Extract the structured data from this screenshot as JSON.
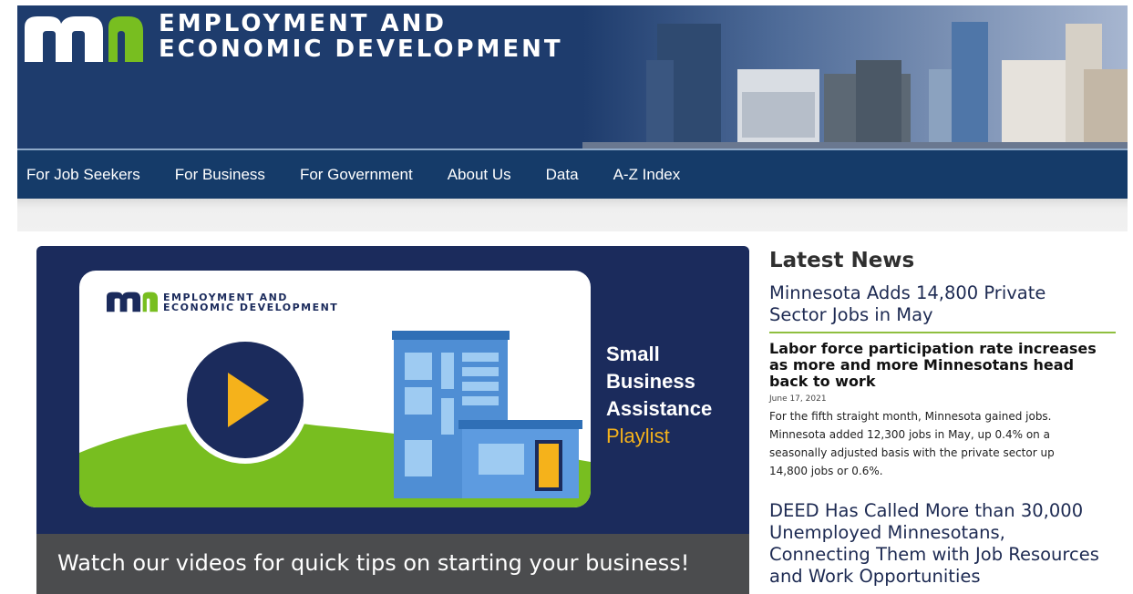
{
  "header": {
    "agency_line1": "EMPLOYMENT AND",
    "agency_line2": "ECONOMIC DEVELOPMENT",
    "colors": {
      "background": "#1e3c6d",
      "logo_green": "#78be20",
      "logo_white": "#ffffff"
    }
  },
  "nav": {
    "items": [
      {
        "label": "For Job Seekers"
      },
      {
        "label": "For Business"
      },
      {
        "label": "For Government"
      },
      {
        "label": "About Us"
      },
      {
        "label": "Data"
      },
      {
        "label": "A-Z Index"
      }
    ]
  },
  "promo": {
    "card_agency_line1": "EMPLOYMENT AND",
    "card_agency_line2": "ECONOMIC DEVELOPMENT",
    "title_line1": "Small",
    "title_line2": "Business",
    "title_line3": "Assistance",
    "title_line4": "Playlist",
    "caption": "Watch our videos for quick tips on starting your business!",
    "icon": "play-icon",
    "colors": {
      "background": "#1b2b5c",
      "accent": "#f5b21b",
      "caption_bg": "#4b4c4e"
    }
  },
  "news": {
    "heading": "Latest News",
    "items": [
      {
        "title_line1": "Minnesota Adds 14,800 Private",
        "title_line2": "Sector Jobs in May",
        "subhead_line1": "Labor force participation rate increases",
        "subhead_line2": "as more and more Minnesotans head",
        "subhead_line3": "back to work",
        "date": "June 17, 2021",
        "body_line1": "For the fifth straight month, Minnesota gained jobs.",
        "body_line2": "Minnesota added 12,300 jobs in May, up 0.4% on a",
        "body_line3": "seasonally adjusted basis with the private sector up",
        "body_line4": "14,800 jobs or 0.6%."
      },
      {
        "title_line1": "DEED Has Called More than 30,000",
        "title_line2": "Unemployed Minnesotans,",
        "title_line3": "Connecting Them with Job Resources",
        "title_line4": "and Work Opportunities"
      }
    ],
    "colors": {
      "divider": "#8fbf3f",
      "link": "#1d2a52"
    }
  }
}
